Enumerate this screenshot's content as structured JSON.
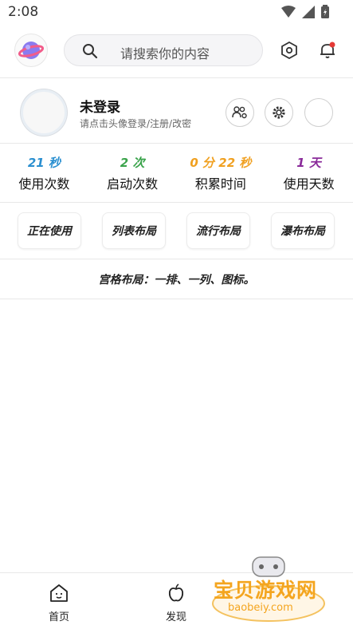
{
  "status_bar": {
    "time": "2:08"
  },
  "header": {
    "search_placeholder": "请搜索你的内容"
  },
  "user": {
    "name": "未登录",
    "hint": "请点击头像登录/注册/改密"
  },
  "stats": [
    {
      "value": "21 秒",
      "label": "使用次数",
      "color": "#2a8fd0"
    },
    {
      "value": "2 次",
      "label": "启动次数",
      "color": "#3aa34b"
    },
    {
      "value": "0 分 22 秒",
      "label": "积累时间",
      "color": "#f0a020"
    },
    {
      "value": "1 天",
      "label": "使用天数",
      "color": "#8a2b9a"
    }
  ],
  "layouts": [
    "正在使用",
    "列表布局",
    "流行布局",
    "瀑布布局"
  ],
  "grid_note": "宫格布局：一排、一列、图标。",
  "tabs": [
    {
      "label": "首页",
      "icon": "home-icon"
    },
    {
      "label": "发现",
      "icon": "apple-icon"
    }
  ],
  "watermark": {
    "text": "宝贝游戏网",
    "url": "baobeiy.com"
  },
  "colors": {
    "accent_red": "#e53935",
    "divider": "#e8e8e8"
  }
}
